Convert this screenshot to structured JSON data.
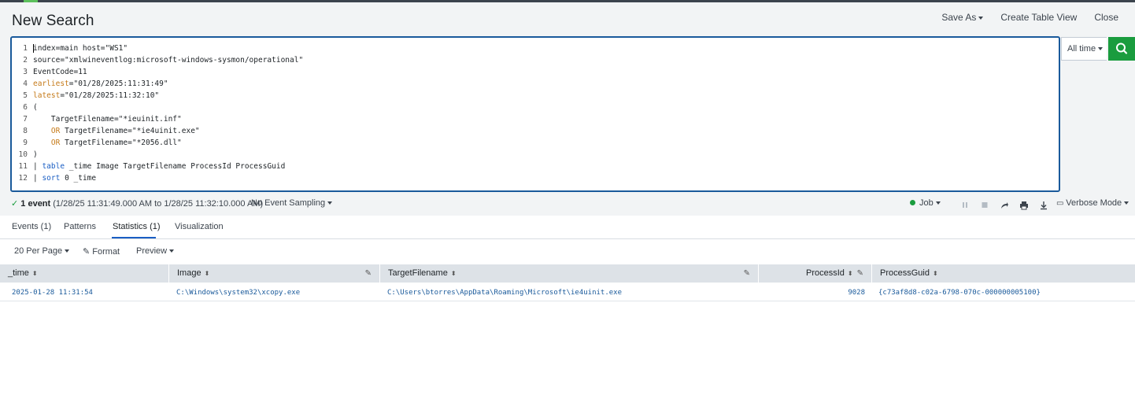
{
  "header": {
    "title": "New Search",
    "actions": [
      "Save As",
      "Create Table View",
      "Close"
    ]
  },
  "search": {
    "lines": [
      {
        "n": "1",
        "parts": [
          {
            "t": "index=main host=\"WS1\"",
            "c": "plain"
          }
        ]
      },
      {
        "n": "2",
        "parts": [
          {
            "t": "source=\"xmlwineventlog:microsoft-windows-sysmon/operational\"",
            "c": "plain"
          }
        ]
      },
      {
        "n": "3",
        "parts": [
          {
            "t": "EventCode=11",
            "c": "plain"
          }
        ]
      },
      {
        "n": "4",
        "parts": [
          {
            "t": "earliest",
            "c": "kw"
          },
          {
            "t": "=\"01/28/2025:11:31:49\"",
            "c": "plain"
          }
        ]
      },
      {
        "n": "5",
        "parts": [
          {
            "t": "latest",
            "c": "kw"
          },
          {
            "t": "=\"01/28/2025:11:32:10\"",
            "c": "plain"
          }
        ]
      },
      {
        "n": "6",
        "parts": [
          {
            "t": "(",
            "c": "plain"
          }
        ]
      },
      {
        "n": "7",
        "parts": [
          {
            "t": "    TargetFilename=\"*ieuinit.inf\"",
            "c": "plain"
          }
        ]
      },
      {
        "n": "8",
        "parts": [
          {
            "t": "    ",
            "c": "plain"
          },
          {
            "t": "OR",
            "c": "kw"
          },
          {
            "t": " TargetFilename=\"*ie4uinit.exe\"",
            "c": "plain"
          }
        ]
      },
      {
        "n": "9",
        "parts": [
          {
            "t": "    ",
            "c": "plain"
          },
          {
            "t": "OR",
            "c": "kw"
          },
          {
            "t": " TargetFilename=\"*2056.dll\"",
            "c": "plain"
          }
        ]
      },
      {
        "n": "10",
        "parts": [
          {
            "t": ")",
            "c": "plain"
          }
        ]
      },
      {
        "n": "11",
        "parts": [
          {
            "t": "| ",
            "c": "plain"
          },
          {
            "t": "table",
            "c": "cmd"
          },
          {
            "t": " _time Image TargetFilename ProcessId ProcessGuid",
            "c": "plain"
          }
        ]
      },
      {
        "n": "12",
        "parts": [
          {
            "t": "| ",
            "c": "plain"
          },
          {
            "t": "sort",
            "c": "cmd"
          },
          {
            "t": " 0 _time",
            "c": "plain"
          }
        ]
      }
    ],
    "time_range": "All time"
  },
  "status": {
    "event_count": "1 event",
    "range": "(1/28/25 11:31:49.000 AM to 1/28/25 11:32:10.000 AM)",
    "sampling": "No Event Sampling",
    "job": "Job",
    "mode": "Verbose Mode"
  },
  "tabs": [
    "Events (1)",
    "Patterns",
    "Statistics (1)",
    "Visualization"
  ],
  "toolbar": {
    "per_page": "20 Per Page",
    "format": "Format",
    "preview": "Preview"
  },
  "table": {
    "columns": [
      "_time",
      "Image",
      "TargetFilename",
      "ProcessId",
      "ProcessGuid"
    ],
    "rows": [
      [
        "2025-01-28 11:31:54",
        "C:\\Windows\\system32\\xcopy.exe",
        "C:\\Users\\btorres\\AppData\\Roaming\\Microsoft\\ie4uinit.exe",
        "9028",
        "{c73af8d8-c02a-6798-070c-000000005100}"
      ]
    ]
  },
  "colors": {
    "accent_blue": "#1a5a9b",
    "search_green": "#1a9c3e",
    "keyword_orange": "#c57a19"
  }
}
